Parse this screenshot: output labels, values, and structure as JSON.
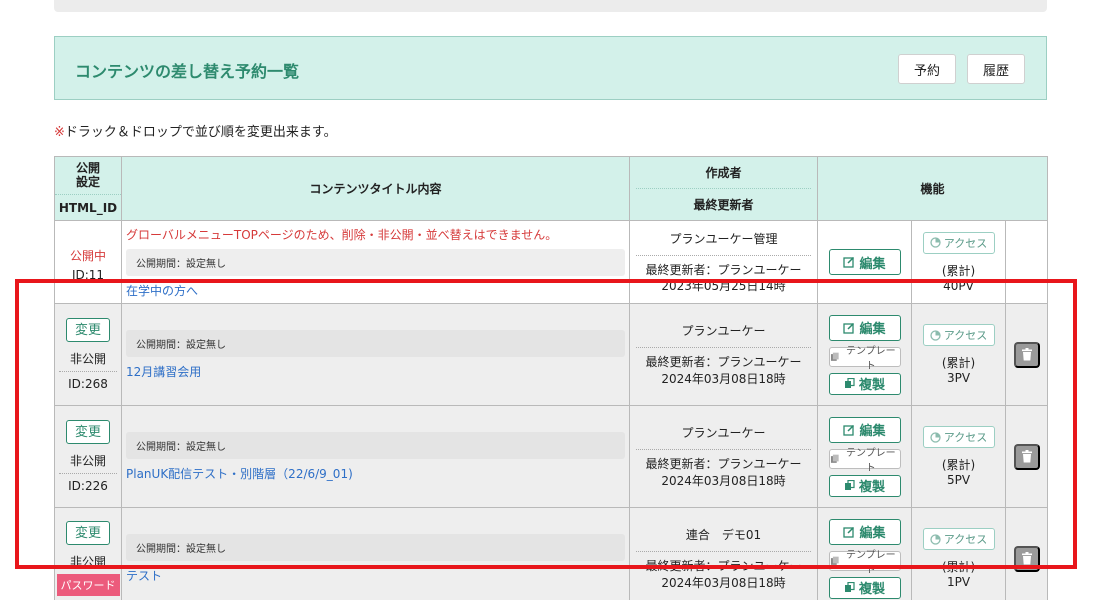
{
  "header": {
    "title": "コンテンツの差し替え予約一覧",
    "reserve_label": "予約",
    "history_label": "履歴"
  },
  "notice": {
    "mark": "※",
    "text": "ドラック＆ドロップで並び順を変更出来ます。"
  },
  "table": {
    "headers": {
      "pub_line1": "公開",
      "pub_line2": "設定",
      "html_id": "HTML_ID",
      "title": "コンテンツタイトル内容",
      "author": "作成者",
      "updater": "最終更新者",
      "func": "機能"
    },
    "rows": [
      {
        "status": "公開中",
        "id": "ID:11",
        "warning": "グローバルメニューTOPページのため、削除・非公開・並べ替えはできません。",
        "period": "公開期間：設定無し",
        "title": "在学中の方へ",
        "author": "プランユーケー管理",
        "updater": "最終更新者：プランユーケー",
        "updated_at": "2023年05月25日14時",
        "pv_label": "(累計)",
        "pv": "40PV"
      },
      {
        "change_label": "変更",
        "status": "非公開",
        "id": "ID:268",
        "period": "公開期間：設定無し",
        "title": "12月講習会用",
        "author": "プランユーケー",
        "updater": "最終更新者：プランユーケー",
        "updated_at": "2024年03月08日18時",
        "pv_label": "(累計)",
        "pv": "3PV"
      },
      {
        "change_label": "変更",
        "status": "非公開",
        "id": "ID:226",
        "period": "公開期間：設定無し",
        "title": "PlanUK配信テスト・別階層（22/6/9_01)",
        "author": "プランユーケー",
        "updater": "最終更新者：プランユーケー",
        "updated_at": "2024年03月08日18時",
        "pv_label": "(累計)",
        "pv": "5PV"
      },
      {
        "change_label": "変更",
        "status": "非公開",
        "badge": "パスワード",
        "period": "公開期間：設定無し",
        "title": "テスト",
        "author": "連合　デモ01",
        "updater": "最終更新者：プランユーケー",
        "updated_at": "2024年03月08日18時",
        "pv_label": "(累計)",
        "pv": "1PV"
      }
    ],
    "buttons": {
      "edit": "編集",
      "template": "テンプレート",
      "copy": "複製",
      "access": "アクセス"
    }
  },
  "colors": {
    "accent": "#2d8a6e",
    "header_bg": "#d3f1ea",
    "warning": "#d63a3a",
    "link": "#2e6fc7",
    "highlight_frame": "#e8161b",
    "badge": "#ec5b7c"
  },
  "icons": [
    "edit-icon",
    "template-icon",
    "copy-icon",
    "access-chart-icon",
    "trash-icon"
  ]
}
